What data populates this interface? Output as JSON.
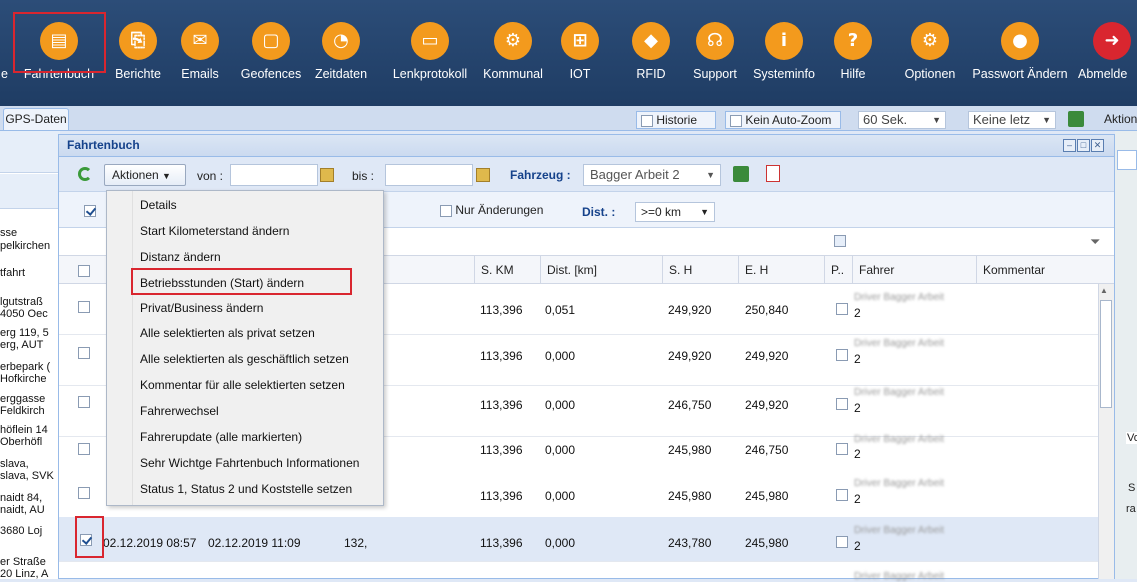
{
  "toolbar": {
    "items": [
      {
        "label": "e",
        "icon": "partial-icon"
      },
      {
        "label": "Fahrtenbuch",
        "icon": "logbook-icon",
        "glyph": "▤"
      },
      {
        "label": "Berichte",
        "icon": "pdf-report-icon",
        "glyph": "⎘"
      },
      {
        "label": "Emails",
        "icon": "envelope-icon",
        "glyph": "✉"
      },
      {
        "label": "Geofences",
        "icon": "geofence-icon",
        "glyph": "▢"
      },
      {
        "label": "Zeitdaten",
        "icon": "clock-icon",
        "glyph": "◔"
      },
      {
        "label": "Lenkprotokoll",
        "icon": "card-icon",
        "glyph": "▭"
      },
      {
        "label": "Kommunal",
        "icon": "tractor-icon",
        "glyph": "⚙"
      },
      {
        "label": "IOT",
        "icon": "network-icon",
        "glyph": "⊞"
      },
      {
        "label": "RFID",
        "icon": "tag-icon",
        "glyph": "◆"
      },
      {
        "label": "Support",
        "icon": "headset-icon",
        "glyph": "☊"
      },
      {
        "label": "Systeminfo",
        "icon": "info-icon",
        "glyph": "i"
      },
      {
        "label": "Hilfe",
        "icon": "help-icon",
        "glyph": "?"
      },
      {
        "label": "Optionen",
        "icon": "gear-icon",
        "glyph": "⚙"
      },
      {
        "label": "Passwort Ändern",
        "icon": "user-icon",
        "glyph": "●"
      },
      {
        "label": "Abmelde",
        "icon": "logout-icon",
        "glyph": "➜"
      }
    ]
  },
  "bar2": {
    "tab": "GPS-Daten",
    "historie": "Historie",
    "kein_auto_zoom": "Kein Auto-Zoom",
    "interval": "60 Sek.",
    "keine_letz": "Keine letz",
    "aktion": "Aktion"
  },
  "left_panel": [
    "sse",
    "pelkirchen",
    "tfahrt",
    "lgutstraß",
    "4050 Oec",
    "erg 119, 5",
    "erg, AUT",
    "erbepark (",
    "Hofkirche",
    "erggasse",
    "Feldkirch",
    "höflein 14",
    "Oberhöfl",
    "slava,",
    "slava, SVK",
    "naidt 84,",
    "naidt, AU",
    "3680 Loj",
    "er Straße",
    "20 Linz, A"
  ],
  "dialog": {
    "title": "Fahrtenbuch",
    "aktionen": "Aktionen",
    "von": "von :",
    "bis": "bis :",
    "fahrzeug_label": "Fahrzeug :",
    "fahrzeug_value": "Bagger Arbeit 2",
    "nur_aenderungen": "Nur Änderungen",
    "dist_label": "Dist. :",
    "dist_value": ">=0 km"
  },
  "columns": [
    "S. KM",
    "Dist. [km]",
    "S. H",
    "E. H",
    "P..",
    "Fahrer",
    "Kommentar"
  ],
  "rows": [
    {
      "skm": "113,396",
      "dist": "0,051",
      "sh": "249,920",
      "eh": "250,840",
      "fahrer_suffix": "2",
      "selected": false
    },
    {
      "skm": "113,396",
      "dist": "0,000",
      "sh": "249,920",
      "eh": "249,920",
      "fahrer_suffix": "2",
      "selected": false
    },
    {
      "skm": "113,396",
      "dist": "0,000",
      "sh": "246,750",
      "eh": "249,920",
      "fahrer_suffix": "2",
      "selected": false
    },
    {
      "skm": "113,396",
      "dist": "0,000",
      "sh": "245,980",
      "eh": "246,750",
      "fahrer_suffix": "2",
      "selected": false
    },
    {
      "skm": "113,396",
      "dist": "0,000",
      "sh": "245,980",
      "eh": "245,980",
      "fahrer_suffix": "2",
      "selected": false
    },
    {
      "start": "02.12.2019 08:57",
      "ende": "02.12.2019 11:09",
      "km": "132,",
      "skm": "113,396",
      "dist": "0,000",
      "sh": "243,780",
      "eh": "245,980",
      "fahrer_suffix": "2",
      "selected": true
    }
  ],
  "menu": [
    "Details",
    "Start Kilometerstand ändern",
    "Distanz ändern",
    "Betriebsstunden (Start) ändern",
    "Privat/Business ändern",
    "Alle selektierten als privat setzen",
    "Alle selektierten als geschäftlich setzen",
    "Kommentar für alle selektierten setzen",
    "Fahrerwechsel",
    "Fahrerupdate (alle markierten)",
    "Sehr Wichtge Fahrtenbuch Informationen",
    "Status 1, Status 2 und Koststelle setzen"
  ],
  "map_labels": [
    "Vo",
    "S",
    "ra"
  ],
  "colors": {
    "accent_orange": "#f39a1d",
    "toolbar_bg": "#1d3a61",
    "highlight_red": "#d9262f",
    "selected_row": "#dfe8f6"
  }
}
